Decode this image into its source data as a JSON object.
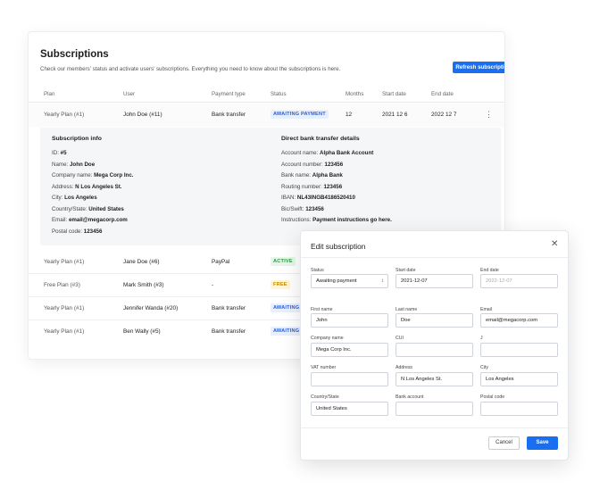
{
  "subscriptions": {
    "title": "Subscriptions",
    "subtitle": "Check our members' status and activate users' subscriptions. Everything you need to know about the subscriptions is here.",
    "refresh_label": "Refresh subscriptions",
    "columns": [
      "Plan",
      "User",
      "Payment type",
      "Status",
      "Months",
      "Start date",
      "End date"
    ],
    "rows": [
      {
        "plan": "Yearly Plan (#1)",
        "user": "John Doe (#11)",
        "payment": "Bank transfer",
        "status": "AWAITING PAYMENT",
        "months": "12",
        "start": "2021 12 6",
        "end": "2022 12 7"
      },
      {
        "plan": "Yearly Plan (#1)",
        "user": "Jane Doe (#6)",
        "payment": "PayPal",
        "status": "ACTIVE"
      },
      {
        "plan": "Free Plan (#3)",
        "user": "Mark Smith (#3)",
        "payment": "-",
        "status": "FREE"
      },
      {
        "plan": "Yearly Plan (#1)",
        "user": "Jennifer Wanda (#20)",
        "payment": "Bank transfer",
        "status": "AWAITING"
      },
      {
        "plan": "Yearly Plan (#1)",
        "user": "Ben Wally (#5)",
        "payment": "Bank transfer",
        "status": "AWAITING"
      }
    ],
    "details": {
      "info_title": "Subscription info",
      "info": [
        {
          "label": "ID:",
          "value": "#5"
        },
        {
          "label": "Name:",
          "value": "John Doe"
        },
        {
          "label": "Company name:",
          "value": "Mega Corp Inc."
        },
        {
          "label": "Address:",
          "value": "N Los Angeles St."
        },
        {
          "label": "City:",
          "value": "Los Angeles"
        },
        {
          "label": "Country/State:",
          "value": "United States"
        },
        {
          "label": "Email:",
          "value": "email@megacorp.com"
        },
        {
          "label": "Postal code:",
          "value": "123456"
        }
      ],
      "bank_title": "Direct bank transfer details",
      "bank": [
        {
          "label": "Account name:",
          "value": "Alpha Bank Account"
        },
        {
          "label": "Account number:",
          "value": "123456"
        },
        {
          "label": "Bank name:",
          "value": "Alpha Bank"
        },
        {
          "label": "Routing number:",
          "value": "123456"
        },
        {
          "label": "IBAN:",
          "value": "NL43INGB4186520410"
        },
        {
          "label": "Bic/Swift:",
          "value": "123456"
        },
        {
          "label": "Instructions:",
          "value": "Payment instructions go here."
        }
      ]
    }
  },
  "modal": {
    "title": "Edit subscription",
    "fields": {
      "status": {
        "label": "Status",
        "value": "Awaiting payment"
      },
      "start_date": {
        "label": "Start date",
        "value": "2021-12-07"
      },
      "end_date": {
        "label": "End date",
        "placeholder": "2022-12-07"
      },
      "first_name": {
        "label": "First name",
        "value": "John"
      },
      "last_name": {
        "label": "Last name",
        "value": "Doe"
      },
      "email": {
        "label": "Email",
        "value": "email@megacorp.com"
      },
      "company": {
        "label": "Company name",
        "value": "Mega Corp Inc."
      },
      "cui": {
        "label": "CUI",
        "value": ""
      },
      "j": {
        "label": "J",
        "value": ""
      },
      "vat": {
        "label": "VAT number",
        "value": ""
      },
      "address": {
        "label": "Address",
        "value": "N Los Angeles St."
      },
      "city": {
        "label": "City",
        "value": "Los Angeles"
      },
      "country": {
        "label": "Country/State",
        "value": "United States"
      },
      "bank_account": {
        "label": "Bank account",
        "value": ""
      },
      "postal": {
        "label": "Postal code",
        "value": ""
      }
    },
    "cancel_label": "Cancel",
    "save_label": "Save"
  },
  "colors": {
    "accent": "#1a6ff0",
    "awaiting": "#2a5fd8",
    "active": "#2a9a45",
    "free": "#c48a05"
  },
  "icons": {
    "row_menu": "kebab-icon",
    "collapse": "chevron-up-icon",
    "close": "close-icon",
    "select": "select-arrows-icon"
  }
}
